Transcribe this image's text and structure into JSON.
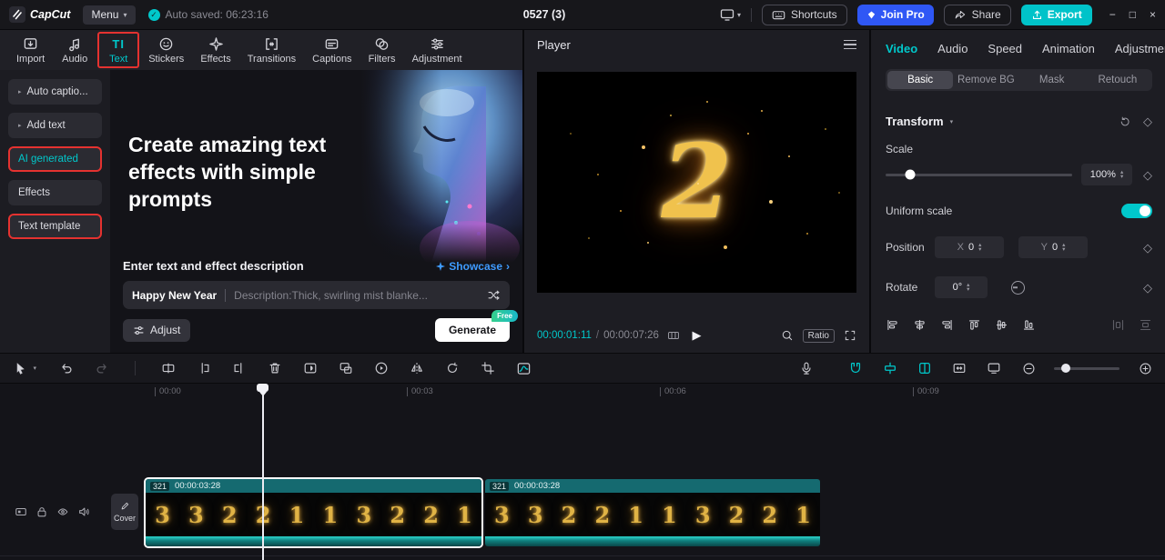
{
  "icons": {
    "caret_down": "▾",
    "check": "✓",
    "triangle_right": "▸",
    "chevron_right": "›",
    "play": "▶",
    "diamond": "◇",
    "step_up": "▴",
    "step_down": "▾",
    "minimize": "−",
    "maximize": "□",
    "close": "×",
    "text_tab_glyph": "TI"
  },
  "topbar": {
    "logo_text": "CapCut",
    "menu_label": "Menu",
    "autosave_text": "Auto saved: 06:23:16",
    "title": "0527 (3)",
    "shortcuts_label": "Shortcuts",
    "join_pro_label": "Join Pro",
    "share_label": "Share",
    "export_label": "Export"
  },
  "ribbon": {
    "tabs": [
      {
        "label": "Import"
      },
      {
        "label": "Audio"
      },
      {
        "label": "Text"
      },
      {
        "label": "Stickers"
      },
      {
        "label": "Effects"
      },
      {
        "label": "Transitions"
      },
      {
        "label": "Captions"
      },
      {
        "label": "Filters"
      },
      {
        "label": "Adjustment"
      }
    ]
  },
  "sidebar": {
    "items": [
      {
        "label": "Auto captio..."
      },
      {
        "label": "Add text"
      },
      {
        "label": "AI generated"
      },
      {
        "label": "Effects"
      },
      {
        "label": "Text template"
      }
    ]
  },
  "ai_text_panel": {
    "heading": "Create amazing text effects with simple prompts",
    "input_label": "Enter text and effect description",
    "showcase_label": "Showcase",
    "prompt_text": "Happy New Year",
    "prompt_description": "Description:Thick, swirling mist blanke...",
    "adjust_label": "Adjust",
    "generate_label": "Generate",
    "free_badge": "Free"
  },
  "player": {
    "title": "Player",
    "preview_glyph": "2",
    "current_time": "00:00:01:11",
    "time_separator": "/",
    "duration": "00:00:07:26",
    "ratio_label": "Ratio"
  },
  "properties": {
    "tabs": [
      {
        "label": "Video"
      },
      {
        "label": "Audio"
      },
      {
        "label": "Speed"
      },
      {
        "label": "Animation"
      },
      {
        "label": "Adjustment"
      }
    ],
    "subtabs": [
      {
        "label": "Basic"
      },
      {
        "label": "Remove BG"
      },
      {
        "label": "Mask"
      },
      {
        "label": "Retouch"
      }
    ],
    "transform_label": "Transform",
    "scale_label": "Scale",
    "scale_value": "100%",
    "uniform_scale_label": "Uniform scale",
    "position_label": "Position",
    "position_x_label": "X",
    "position_x_value": "0",
    "position_y_label": "Y",
    "position_y_value": "0",
    "rotate_label": "Rotate",
    "rotate_value": "0°"
  },
  "timeline": {
    "ruler_labels": [
      "00:00",
      "00:03",
      "00:06",
      "00:09"
    ],
    "cover_label": "Cover",
    "clips": [
      {
        "badge": "321",
        "duration": "00:00:03:28"
      },
      {
        "badge": "321",
        "duration": "00:00:03:28"
      }
    ],
    "thumb_glyphs": [
      "3",
      "3",
      "2",
      "2",
      "1",
      "1",
      "3",
      "2",
      "2",
      "1"
    ]
  }
}
